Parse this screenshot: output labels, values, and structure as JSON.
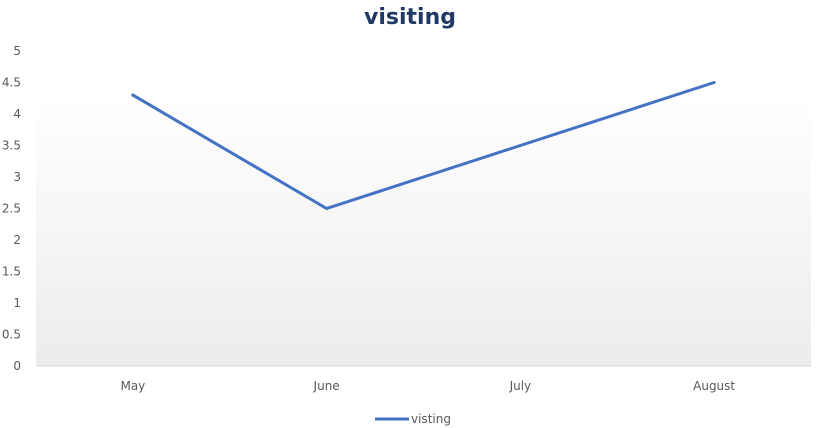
{
  "chart_data": {
    "type": "line",
    "title": "visiting",
    "categories": [
      "May",
      "June",
      "July",
      "August"
    ],
    "series": [
      {
        "name": "visting",
        "values": [
          4.3,
          2.5,
          3.5,
          4.5
        ],
        "color": "#4472c4"
      }
    ],
    "ylim": [
      0,
      5
    ],
    "yticks": [
      "0",
      "0.5",
      "1",
      "1.5",
      "2",
      "2.5",
      "3",
      "3.5",
      "4",
      "4.5",
      "5"
    ],
    "grid": false,
    "legend_position": "bottom",
    "plot_background": "gradient white to light gray"
  }
}
